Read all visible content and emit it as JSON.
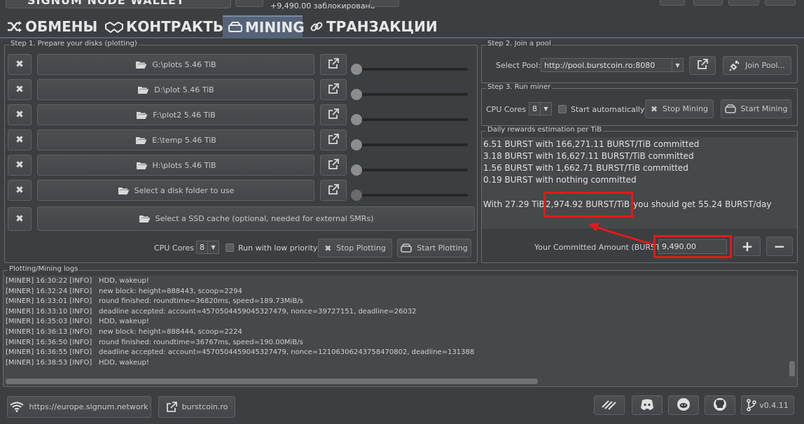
{
  "header": {
    "title_partial": "SIGNUM NODE WALLET",
    "locked_text": "+9,490.00 заблокировано"
  },
  "tabs": [
    {
      "label": "ОБМЕНЫ",
      "icon": "shuffle-icon",
      "active": false
    },
    {
      "label": "КОНТРАКТЫ",
      "icon": "handshake-icon",
      "active": false
    },
    {
      "label": "MINING",
      "icon": "hdd-icon",
      "active": true
    },
    {
      "label": "ТРАНЗАКЦИИ",
      "icon": "link-icon",
      "active": false
    }
  ],
  "step1": {
    "title": "Step 1. Prepare your disks (plotting)",
    "disks": [
      {
        "label": "G:\\plots 5.46 TiB"
      },
      {
        "label": "D:\\plot 5.46 TiB"
      },
      {
        "label": "F:\\plot2 5.46 TiB"
      },
      {
        "label": "E:\\temp 5.46 TiB"
      },
      {
        "label": "H:\\plots 5.46 TiB"
      },
      {
        "label": "Select a disk folder to use"
      }
    ],
    "ssd_label": "Select a SSD cache (optional, needed for external SMRs)",
    "cpu_label": "CPU Cores",
    "cpu_value": "8",
    "low_priority_label": "Run with low priority",
    "stop_label": "Stop Plotting",
    "start_label": "Start Plotting"
  },
  "step2": {
    "title": "Step 2. Join a pool",
    "pool_label": "Select Pool:",
    "pool_value": "http://pool.burstcoin.ro:8080",
    "join_label": "Join Pool..."
  },
  "step3": {
    "title": "Step 3. Run miner",
    "cpu_label": "CPU Cores",
    "cpu_value": "8",
    "auto_label": "Start automatically",
    "stop_label": "Stop Mining",
    "start_label": "Start Mining"
  },
  "rewards": {
    "title": "Daily rewards estimation per TiB",
    "lines": [
      "6.51 BURST with 166,271.11 BURST/TiB committed",
      "3.18 BURST with 16,627.11 BURST/TiB committed",
      "1.56 BURST with 1,662.71 BURST/TiB committed",
      "0.19 BURST with nothing committed"
    ],
    "summary_prefix": "With 27.29 TiB",
    "summary_highlight": "2,974.92 BURST/TiB",
    "summary_suffix": "you should get 55.24 BURST/day",
    "committed_label": "Your Committed Amount (BURST):",
    "committed_value": "9,490.00",
    "plus": "+",
    "minus": "−"
  },
  "logs": {
    "title": "Plotting/Mining logs",
    "lines": [
      {
        "t": "[MINER] 16:30:22 [INFO]",
        "m": "HDD, wakeup!"
      },
      {
        "t": "[MINER] 16:32:24 [INFO]",
        "m": "new block: height=888443, scoop=2294"
      },
      {
        "t": "[MINER] 16:33:01 [INFO]",
        "m": "round finished: roundtime=36820ms, speed=189.73MiB/s"
      },
      {
        "t": "[MINER] 16:33:10 [INFO]",
        "m": "deadline accepted: account=4570504459045327479, nonce=39727151, deadline=26032"
      },
      {
        "t": "[MINER] 16:35:03 [INFO]",
        "m": "HDD, wakeup!"
      },
      {
        "t": "[MINER] 16:36:13 [INFO]",
        "m": "new block: height=888444, scoop=2224"
      },
      {
        "t": "[MINER] 16:36:50 [INFO]",
        "m": "round finished: roundtime=36767ms, speed=190.00MiB/s"
      },
      {
        "t": "[MINER] 16:36:55 [INFO]",
        "m": "deadline accepted: account=4570504459045327479, nonce=12106306243758470802, deadline=131388"
      },
      {
        "t": "[MINER] 16:38:53 [INFO]",
        "m": "HDD, wakeup!"
      }
    ]
  },
  "footer": {
    "node_label": "https://europe.signum.network",
    "explorer_label": "burstcoin.ro",
    "version": "v0.4.11"
  },
  "colors": {
    "highlight": "#e01b1b",
    "background": "#3c3f41"
  }
}
